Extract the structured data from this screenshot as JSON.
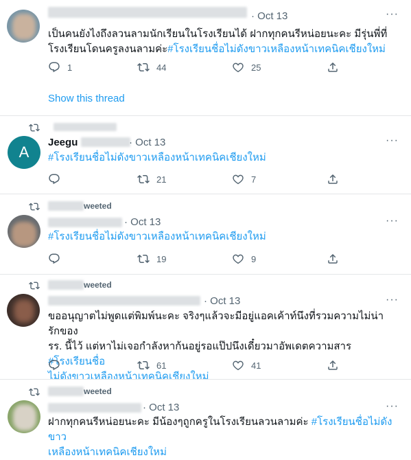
{
  "tweets": [
    {
      "time": "· Oct 13",
      "text_plain": "เป็นคนยังไงถึงลวนลามนักเรียนในโรงเรียนได้ ฝากทุกคนรีหน่อยนะคะ มีรุ่นพี่ที่โรงเรียนโดนครูลงนลามค่ะ",
      "hashtag": "#โรงเรียนชื่อไม่ดังขาวเหลืองหน้าเทคนิคเชียงใหม่",
      "replies": "1",
      "retweets": "44",
      "likes": "25",
      "show_thread": "Show this thread"
    },
    {
      "retweet_label": "",
      "name_fragment": "Jeegu",
      "handle_fragment": "@...",
      "avatar_letter": "A",
      "time": "· Oct 13",
      "hashtag": "#โรงเรียนชื่อไม่ดังขาวเหลืองหน้าเทคนิคเชียงใหม่",
      "replies": "",
      "retweets": "21",
      "likes": "7"
    },
    {
      "retweet_label": "weeted",
      "time": "· Oct 13",
      "hashtag": "#โรงเรียนชื่อไม่ดังขาวเหลืองหน้าเทคนิคเชียงใหม่",
      "replies": "",
      "retweets": "19",
      "likes": "9"
    },
    {
      "retweet_label": "weeted",
      "time": "· Oct 13",
      "line1": "ขออนุญาตไม่พูดแต่พิมพ์นะคะ จริงๆแล้วจะมีอยู่แอคเค้าท์นึงที่รวมความไม่น่ารักของ",
      "line2_plain": "รร. นี้ไว้ แต่หาไม่เจอกำลังหาก้นอยู่รอแป๊ปนึงเดี๋ยวมาอัพเดตความสาร ",
      "line2_hashtag": "#โรงเรียนชื่อ",
      "line3_hashtag": "ไม่ดังขาวเหลืองหน้าเทคนิคเชียงใหม่",
      "replies": "",
      "retweets": "61",
      "likes": "41"
    },
    {
      "retweet_label": "weeted",
      "time": "· Oct 13",
      "line1_plain": "ฝากทุกคนรีหน่อยนะคะ มีน้องๆถูกครูในโรงเรียนลวนลามค่ะ ",
      "line1_hashtag": "#โรงเรียนชื่อไม่ดังขาว",
      "line2_hashtag": "เหลืองหน้าเทคนิคเชียงใหม่"
    }
  ],
  "icons": {
    "reply": "reply-icon",
    "retweet": "retweet-icon",
    "like": "like-icon",
    "share": "share-icon",
    "more": "more-icon"
  },
  "colors": {
    "link": "#1d9bf0",
    "muted": "#536471",
    "avatar_teal": "#11838f"
  }
}
